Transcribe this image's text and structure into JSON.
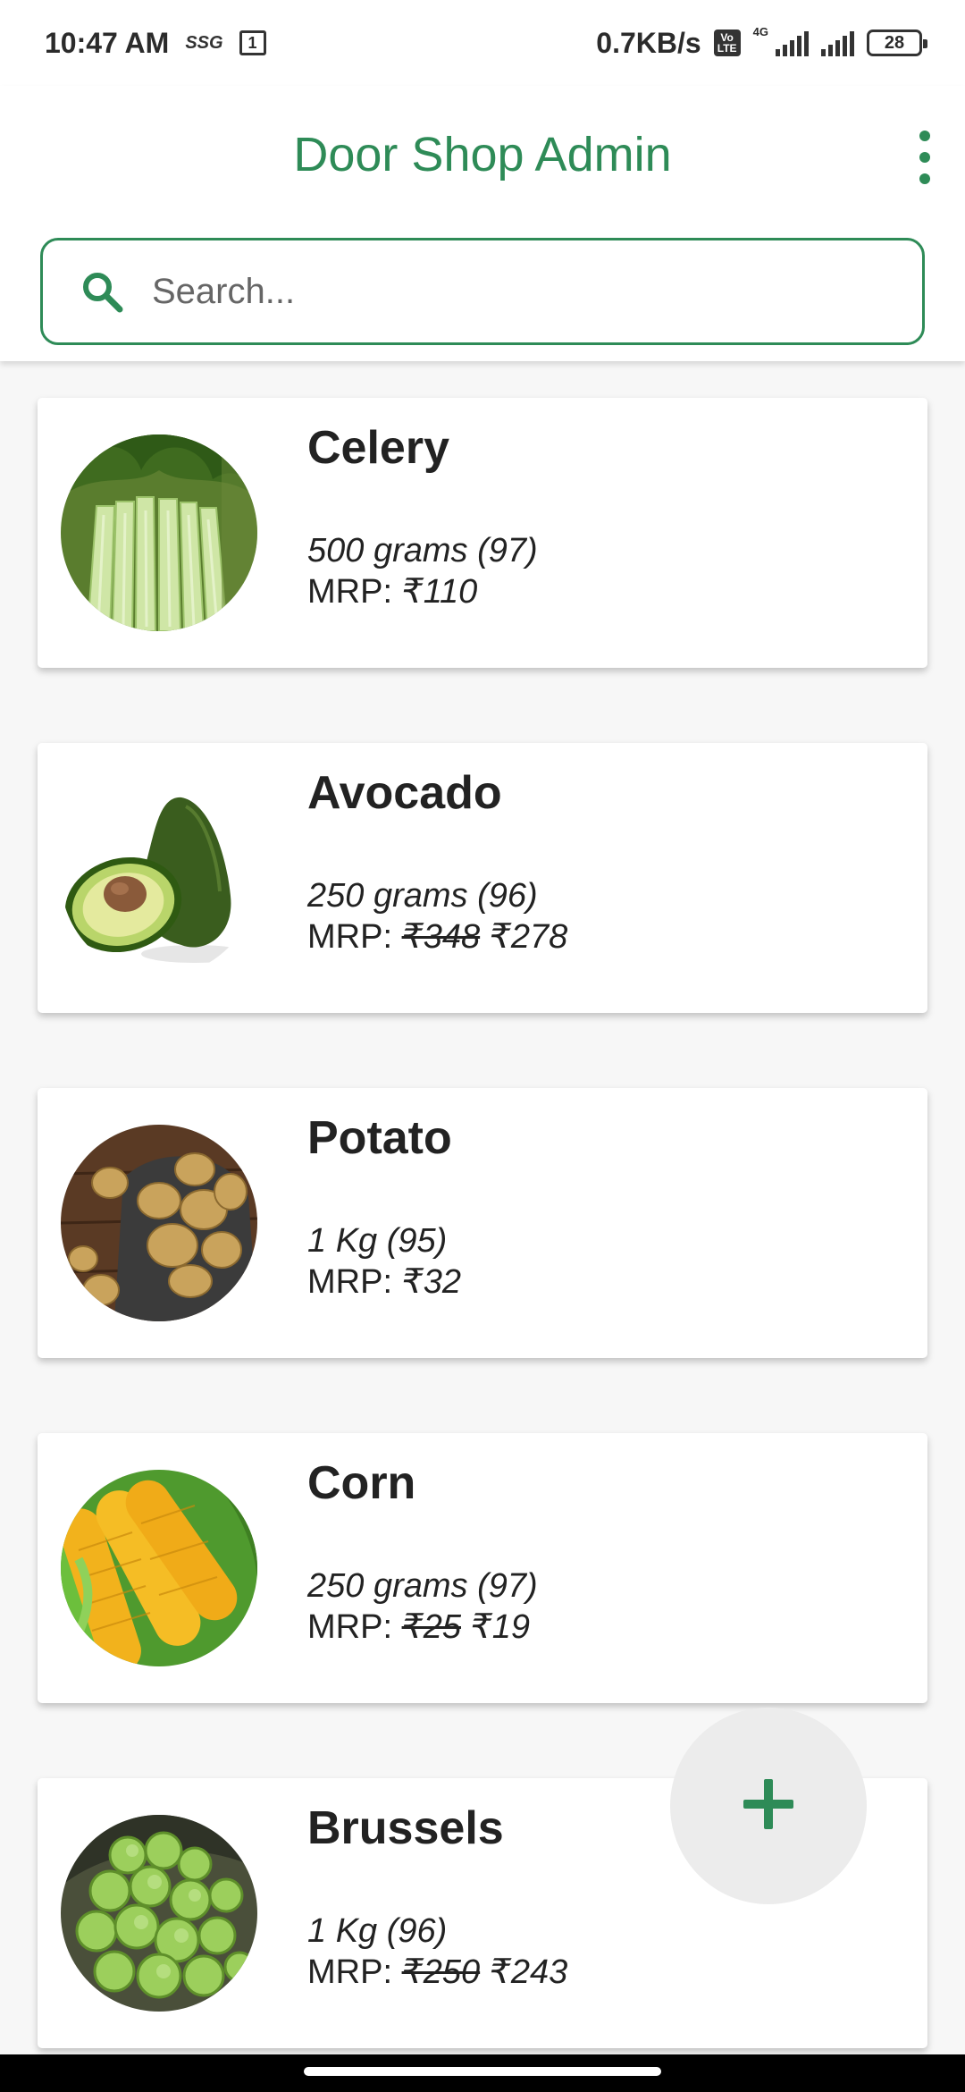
{
  "status_bar": {
    "time": "10:47 AM",
    "carrier_tag": "SSG",
    "notification_badge": "1",
    "network_speed": "0.7KB/s",
    "volte_label": "Vo LTE",
    "network_type": "4G",
    "battery": "28"
  },
  "header": {
    "title": "Door Shop Admin",
    "menu_icon": "more-vert-icon"
  },
  "search": {
    "placeholder": "Search...",
    "value": "",
    "icon": "search-icon"
  },
  "products": [
    {
      "name": "Celery",
      "quantity": "500 grams (97)",
      "mrp_label": "MRP:",
      "old_price": "",
      "price": "₹110",
      "image": "celery"
    },
    {
      "name": "Avocado",
      "quantity": "250 grams (96)",
      "mrp_label": "MRP:",
      "old_price": "₹348",
      "price": "₹278",
      "image": "avocado"
    },
    {
      "name": "Potato",
      "quantity": "1 Kg (95)",
      "mrp_label": "MRP:",
      "old_price": "",
      "price": "₹32",
      "image": "potato"
    },
    {
      "name": "Corn",
      "quantity": "250 grams (97)",
      "mrp_label": "MRP:",
      "old_price": "₹25",
      "price": "₹19",
      "image": "corn"
    },
    {
      "name": "Brussels",
      "quantity": "1 Kg (96)",
      "mrp_label": "MRP:",
      "old_price": "₹250",
      "price": "₹243",
      "image": "brussels"
    }
  ],
  "fab": {
    "icon": "plus-icon"
  },
  "colors": {
    "accent": "#2e8b57",
    "background": "#f7f7f7",
    "card": "#ffffff",
    "fab_background": "#ececec"
  }
}
